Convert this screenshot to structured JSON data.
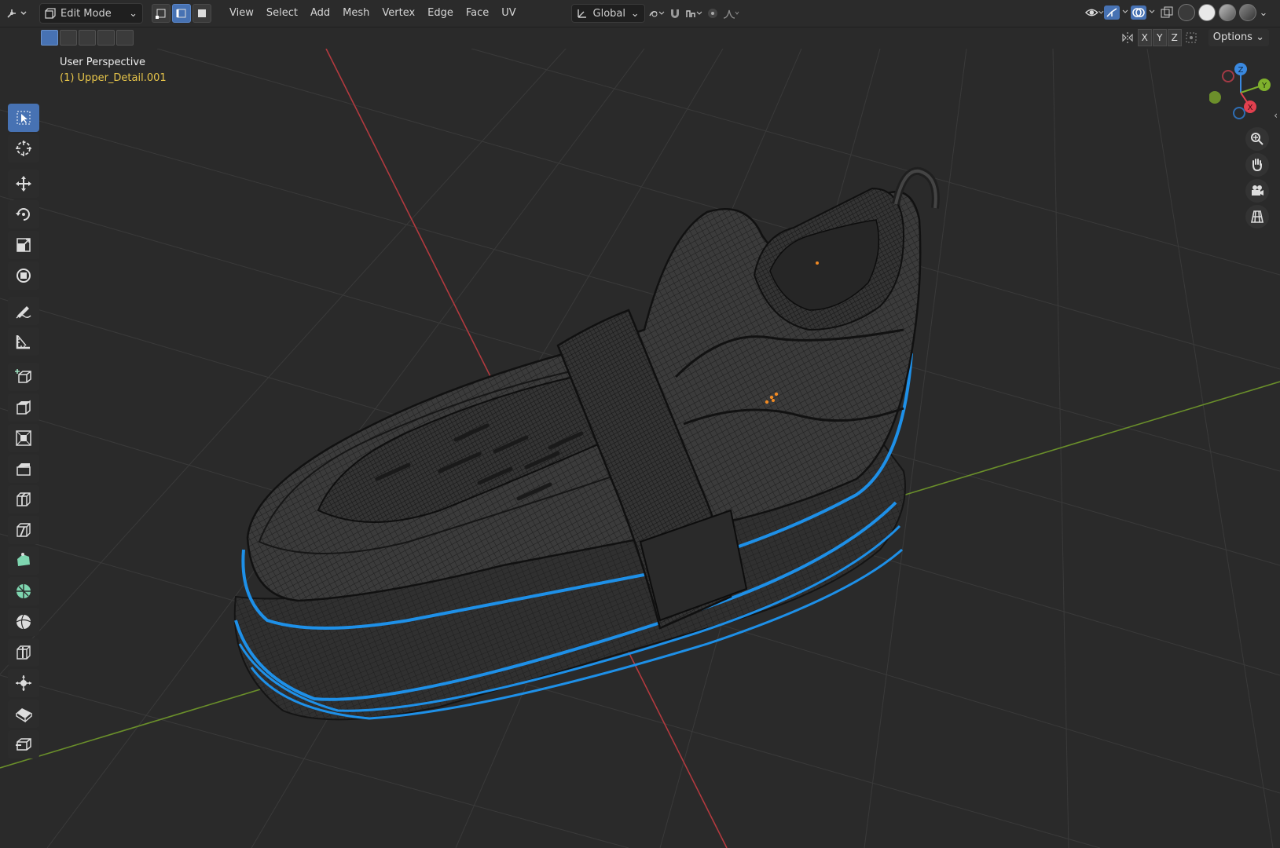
{
  "header": {
    "mode_label": "Edit Mode",
    "menu": [
      "View",
      "Select",
      "Add",
      "Mesh",
      "Vertex",
      "Edge",
      "Face",
      "UV"
    ],
    "orientation_label": "Global",
    "select_mode_active": "edge"
  },
  "toolbar_row": {
    "axes": [
      "X",
      "Y",
      "Z"
    ],
    "options_label": "Options"
  },
  "viewport": {
    "title": "User Perspective",
    "object": "(1) Upper_Detail.001"
  },
  "gizmo": {
    "x_label": "X",
    "y_label": "Y",
    "z_label": "Z"
  },
  "colors": {
    "accent": "#4772b3",
    "object_text": "#e7c54a",
    "axis_x": "#e2404f",
    "axis_y": "#7fb02c",
    "axis_z": "#3a89e0",
    "selection_blue": "#1e90e8",
    "background": "#2b2b2b"
  },
  "tools": [
    "select-box-tool",
    "cursor-tool",
    "move-tool",
    "rotate-tool",
    "scale-tool",
    "transform-tool",
    "annotate-tool",
    "measure-tool",
    "add-cube-tool",
    "extrude-tool",
    "inset-tool",
    "bevel-tool",
    "loop-cut-tool",
    "knife-tool",
    "poly-build-tool",
    "spin-tool",
    "smooth-tool",
    "edge-slide-tool",
    "shrink-fatten-tool",
    "shear-tool",
    "rip-tool"
  ]
}
